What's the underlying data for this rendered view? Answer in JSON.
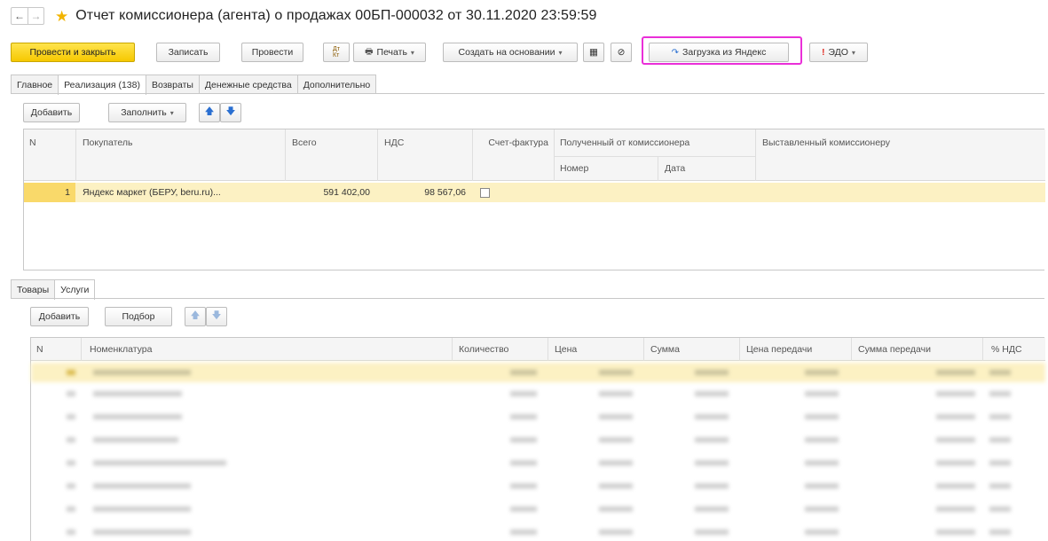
{
  "titlebar": {
    "back": "←",
    "forward": "→",
    "title": "Отчет комиссионера (агента) о продажах 00БП-000032 от 30.11.2020 23:59:59"
  },
  "toolbar": {
    "post_close": "Провести и закрыть",
    "save": "Записать",
    "post": "Провести",
    "dtkt": "Дт Кт",
    "print": "Печать",
    "create_based": "Создать на основании",
    "yandex_load": "Загрузка из Яндекс",
    "edo": "ЭДО"
  },
  "tabs": [
    "Главное",
    "Реализация (138)",
    "Возвраты",
    "Денежные средства",
    "Дополнительно"
  ],
  "sales_panel": {
    "add": "Добавить",
    "fill": "Заполнить"
  },
  "sales_table": {
    "headers": {
      "n": "N",
      "buyer": "Покупатель",
      "total": "Всего",
      "vat": "НДС",
      "invoice": "Счет-фактура",
      "received": "Полученный от комиссионера",
      "number": "Номер",
      "date": "Дата",
      "issued": "Выставленный комиссионеру"
    },
    "rows": [
      {
        "n": "1",
        "buyer": "Яндекс маркет (БЕРУ, beru.ru)...",
        "total": "591 402,00",
        "vat": "98 567,06"
      }
    ]
  },
  "sub_tabs": [
    "Товары",
    "Услуги"
  ],
  "goods_panel": {
    "add": "Добавить",
    "select": "Подбор"
  },
  "goods_table": {
    "headers": {
      "n": "N",
      "item": "Номенклатура",
      "qty": "Количество",
      "price": "Цена",
      "sum": "Сумма",
      "transfer_price": "Цена передачи",
      "transfer_sum": "Сумма передачи",
      "vat_rate": "% НДС"
    }
  },
  "colors": {
    "primary_button": "#f6c800",
    "selection": "#fcf1c3",
    "current_cell": "#f9d96a",
    "highlight_frame": "#ea2fd8",
    "star": "#f2b400"
  }
}
